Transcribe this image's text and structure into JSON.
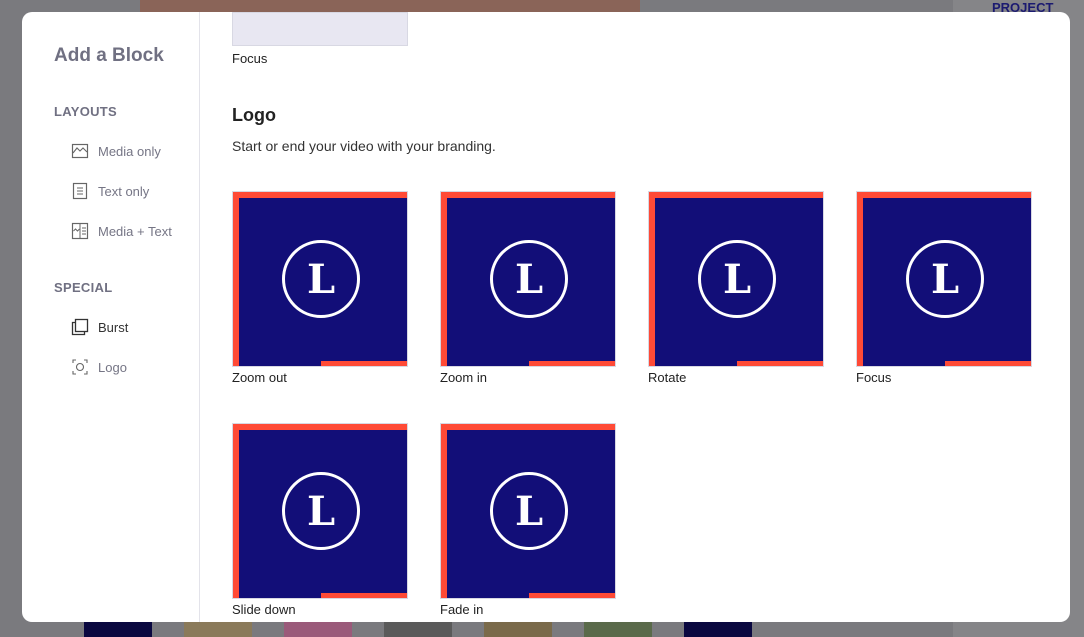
{
  "background": {
    "project_label": "PROJECT"
  },
  "sidebar": {
    "title": "Add a Block",
    "sections": [
      {
        "label": "LAYOUTS",
        "items": [
          {
            "label": "Media only",
            "icon": "image-icon"
          },
          {
            "label": "Text only",
            "icon": "text-icon"
          },
          {
            "label": "Media + Text",
            "icon": "media-text-icon"
          }
        ]
      },
      {
        "label": "SPECIAL",
        "items": [
          {
            "label": "Burst",
            "icon": "burst-icon"
          },
          {
            "label": "Logo",
            "icon": "logo-frame-icon"
          }
        ]
      }
    ]
  },
  "main": {
    "previous_tile_label": "Focus",
    "section_title": "Logo",
    "section_description": "Start or end your video with your branding.",
    "logo_letter": "L",
    "tiles": [
      {
        "label": "Zoom out"
      },
      {
        "label": "Zoom in"
      },
      {
        "label": "Rotate"
      },
      {
        "label": "Focus"
      },
      {
        "label": "Slide down"
      },
      {
        "label": "Fade in"
      }
    ]
  },
  "colors": {
    "navy": "#120e78",
    "accent": "#ff4a36"
  }
}
